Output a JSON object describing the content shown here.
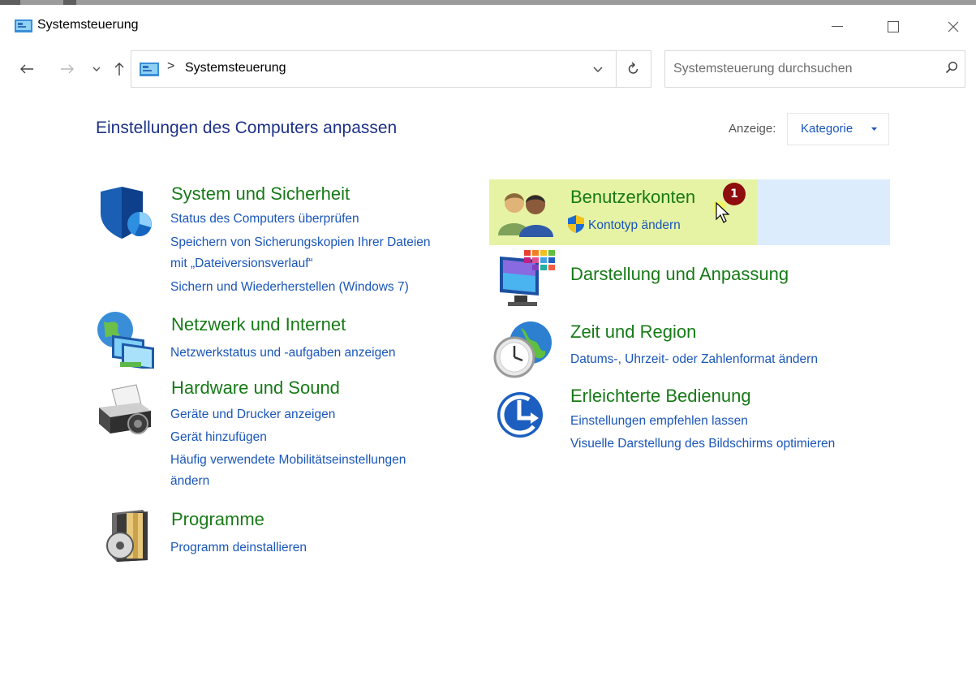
{
  "window": {
    "title": "Systemsteuerung",
    "icon": "control-panel-icon"
  },
  "address": {
    "path_items": [
      "Systemsteuerung"
    ],
    "separator": ">"
  },
  "search": {
    "placeholder": "Systemsteuerung durchsuchen"
  },
  "header": {
    "title": "Einstellungen des Computers anpassen",
    "view_label": "Anzeige:",
    "view_value": "Kategorie"
  },
  "categories": {
    "system": {
      "title": "System und Sicherheit",
      "icon": "shield-icon",
      "links": [
        "Status des Computers überprüfen",
        "Speichern von Sicherungskopien Ihrer Dateien",
        "mit „Dateiversionsverlauf“",
        "Sichern und Wiederherstellen (Windows 7)"
      ]
    },
    "network": {
      "title": "Netzwerk und Internet",
      "icon": "network-icon",
      "links": [
        "Netzwerkstatus und -aufgaben anzeigen"
      ]
    },
    "hardware": {
      "title": "Hardware und Sound",
      "icon": "printer-icon",
      "links": [
        "Geräte und Drucker anzeigen",
        "Gerät hinzufügen",
        "Häufig verwendete Mobilitätseinstellungen",
        "ändern"
      ]
    },
    "programs": {
      "title": "Programme",
      "icon": "programs-icon",
      "links": [
        "Programm deinstallieren"
      ]
    },
    "users": {
      "title": "Benutzerkonten",
      "icon": "users-icon",
      "links": [
        "Kontotyp ändern"
      ],
      "badge": "1"
    },
    "appearance": {
      "title": "Darstellung und Anpassung",
      "icon": "monitor-colors-icon",
      "links": []
    },
    "clock": {
      "title": "Zeit und Region",
      "icon": "clock-globe-icon",
      "links": [
        "Datums-, Uhrzeit- oder Zahlenformat ändern"
      ]
    },
    "access": {
      "title": "Erleichterte Bedienung",
      "icon": "accessibility-icon",
      "links": [
        "Einstellungen empfehlen lassen",
        "Visuelle Darstellung des Bildschirms optimieren"
      ]
    }
  },
  "colors": {
    "category_title": "#177a17",
    "link": "#1a56b9",
    "page_title": "#1e3287",
    "hover_highlight": "#dcecfc",
    "marker_highlight": "#e6f3a4",
    "badge": "#8e0d0d"
  }
}
